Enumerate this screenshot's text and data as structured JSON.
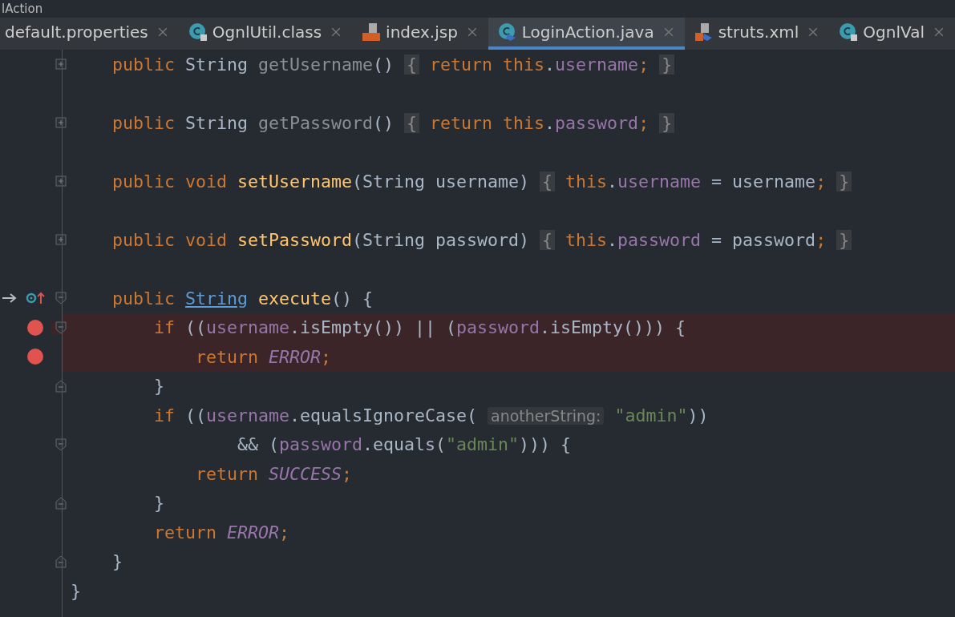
{
  "window": {
    "title": "lAction"
  },
  "tabs": [
    {
      "label": "default.properties",
      "kind": "plain",
      "selected": false
    },
    {
      "label": "OgnlUtil.class",
      "kind": "class",
      "selected": false
    },
    {
      "label": "index.jsp",
      "kind": "jsp",
      "selected": false
    },
    {
      "label": "LoginAction.java",
      "kind": "java",
      "selected": true
    },
    {
      "label": "struts.xml",
      "kind": "xml",
      "selected": false
    },
    {
      "label": "OgnlVal",
      "kind": "class",
      "selected": false
    }
  ],
  "lines": [
    {
      "kind": "code",
      "fold": {
        "kind": "expand"
      },
      "breakpoint": false,
      "tokens": [
        {
          "kind": "kw",
          "text": "    public "
        },
        {
          "kind": "plain",
          "text": "String "
        },
        {
          "kind": "dim",
          "text": "getUsername"
        },
        {
          "kind": "plain",
          "text": "() "
        },
        {
          "kind": "foldbrace",
          "text": "{"
        },
        {
          "kind": "kw",
          "text": " return this"
        },
        {
          "kind": "plain",
          "text": "."
        },
        {
          "kind": "field",
          "text": "username"
        },
        {
          "kind": "kw",
          "text": "; "
        },
        {
          "kind": "foldbrace",
          "text": "}"
        }
      ]
    },
    {
      "kind": "blank"
    },
    {
      "kind": "code",
      "fold": {
        "kind": "expand"
      },
      "breakpoint": false,
      "tokens": [
        {
          "kind": "kw",
          "text": "    public "
        },
        {
          "kind": "plain",
          "text": "String "
        },
        {
          "kind": "dim",
          "text": "getPassword"
        },
        {
          "kind": "plain",
          "text": "() "
        },
        {
          "kind": "foldbrace",
          "text": "{"
        },
        {
          "kind": "kw",
          "text": " return this"
        },
        {
          "kind": "plain",
          "text": "."
        },
        {
          "kind": "field",
          "text": "password"
        },
        {
          "kind": "kw",
          "text": "; "
        },
        {
          "kind": "foldbrace",
          "text": "}"
        }
      ]
    },
    {
      "kind": "blank"
    },
    {
      "kind": "code",
      "fold": {
        "kind": "expand"
      },
      "breakpoint": false,
      "tokens": [
        {
          "kind": "kw",
          "text": "    public void "
        },
        {
          "kind": "fn",
          "text": "setUsername"
        },
        {
          "kind": "plain",
          "text": "(String username) "
        },
        {
          "kind": "foldbrace",
          "text": "{"
        },
        {
          "kind": "kw",
          "text": " this"
        },
        {
          "kind": "plain",
          "text": "."
        },
        {
          "kind": "field",
          "text": "username"
        },
        {
          "kind": "plain",
          "text": " = username"
        },
        {
          "kind": "kw",
          "text": "; "
        },
        {
          "kind": "foldbrace",
          "text": "}"
        }
      ]
    },
    {
      "kind": "blank"
    },
    {
      "kind": "code",
      "fold": {
        "kind": "expand"
      },
      "breakpoint": false,
      "tokens": [
        {
          "kind": "kw",
          "text": "    public void "
        },
        {
          "kind": "fn",
          "text": "setPassword"
        },
        {
          "kind": "plain",
          "text": "(String password) "
        },
        {
          "kind": "foldbrace",
          "text": "{"
        },
        {
          "kind": "kw",
          "text": " this"
        },
        {
          "kind": "plain",
          "text": "."
        },
        {
          "kind": "field",
          "text": "password"
        },
        {
          "kind": "plain",
          "text": " = password"
        },
        {
          "kind": "kw",
          "text": "; "
        },
        {
          "kind": "foldbrace",
          "text": "}"
        }
      ]
    },
    {
      "kind": "blank"
    },
    {
      "kind": "code",
      "fold": {
        "kind": "open"
      },
      "marker": {
        "kind": "override"
      },
      "breakpoint": false,
      "tokens": [
        {
          "kind": "kw",
          "text": "    public "
        },
        {
          "kind": "link",
          "text": "String"
        },
        {
          "kind": "fn",
          "text": " execute"
        },
        {
          "kind": "plain",
          "text": "() {"
        }
      ]
    },
    {
      "kind": "code",
      "fold": {
        "kind": "open"
      },
      "breakpoint": true,
      "tokens": [
        {
          "kind": "kw",
          "text": "        if "
        },
        {
          "kind": "plain",
          "text": "(("
        },
        {
          "kind": "field",
          "text": "username"
        },
        {
          "kind": "plain",
          "text": ".isEmpty()) || ("
        },
        {
          "kind": "field",
          "text": "password"
        },
        {
          "kind": "plain",
          "text": ".isEmpty())) {"
        }
      ]
    },
    {
      "kind": "code",
      "breakpoint": true,
      "tokens": [
        {
          "kind": "kw",
          "text": "            return "
        },
        {
          "kind": "const",
          "text": "ERROR"
        },
        {
          "kind": "kw",
          "text": ";"
        }
      ]
    },
    {
      "kind": "code",
      "fold": {
        "kind": "close"
      },
      "breakpoint": false,
      "tokens": [
        {
          "kind": "plain",
          "text": "        }"
        }
      ]
    },
    {
      "kind": "code",
      "breakpoint": false,
      "tokens": [
        {
          "kind": "kw",
          "text": "        if "
        },
        {
          "kind": "plain",
          "text": "(("
        },
        {
          "kind": "field",
          "text": "username"
        },
        {
          "kind": "plain",
          "text": ".equalsIgnoreCase( "
        },
        {
          "kind": "hint",
          "text": "anotherString:"
        },
        {
          "kind": "string",
          "text": " \"admin\""
        },
        {
          "kind": "plain",
          "text": "))"
        }
      ]
    },
    {
      "kind": "code",
      "fold": {
        "kind": "open"
      },
      "breakpoint": false,
      "tokens": [
        {
          "kind": "plain",
          "text": "                && ("
        },
        {
          "kind": "field",
          "text": "password"
        },
        {
          "kind": "plain",
          "text": ".equals("
        },
        {
          "kind": "string",
          "text": "\"admin\""
        },
        {
          "kind": "plain",
          "text": "))) {"
        }
      ]
    },
    {
      "kind": "code",
      "breakpoint": false,
      "tokens": [
        {
          "kind": "kw",
          "text": "            return "
        },
        {
          "kind": "const",
          "text": "SUCCESS"
        },
        {
          "kind": "kw",
          "text": ";"
        }
      ]
    },
    {
      "kind": "code",
      "fold": {
        "kind": "close"
      },
      "breakpoint": false,
      "tokens": [
        {
          "kind": "plain",
          "text": "        }"
        }
      ]
    },
    {
      "kind": "code",
      "breakpoint": false,
      "tokens": [
        {
          "kind": "kw",
          "text": "        return "
        },
        {
          "kind": "const",
          "text": "ERROR"
        },
        {
          "kind": "kw",
          "text": ";"
        }
      ]
    },
    {
      "kind": "code",
      "fold": {
        "kind": "close"
      },
      "breakpoint": false,
      "tokens": [
        {
          "kind": "plain",
          "text": "    }"
        }
      ]
    },
    {
      "kind": "code",
      "breakpoint": false,
      "tokens": [
        {
          "kind": "plain",
          "text": "}"
        }
      ]
    }
  ]
}
